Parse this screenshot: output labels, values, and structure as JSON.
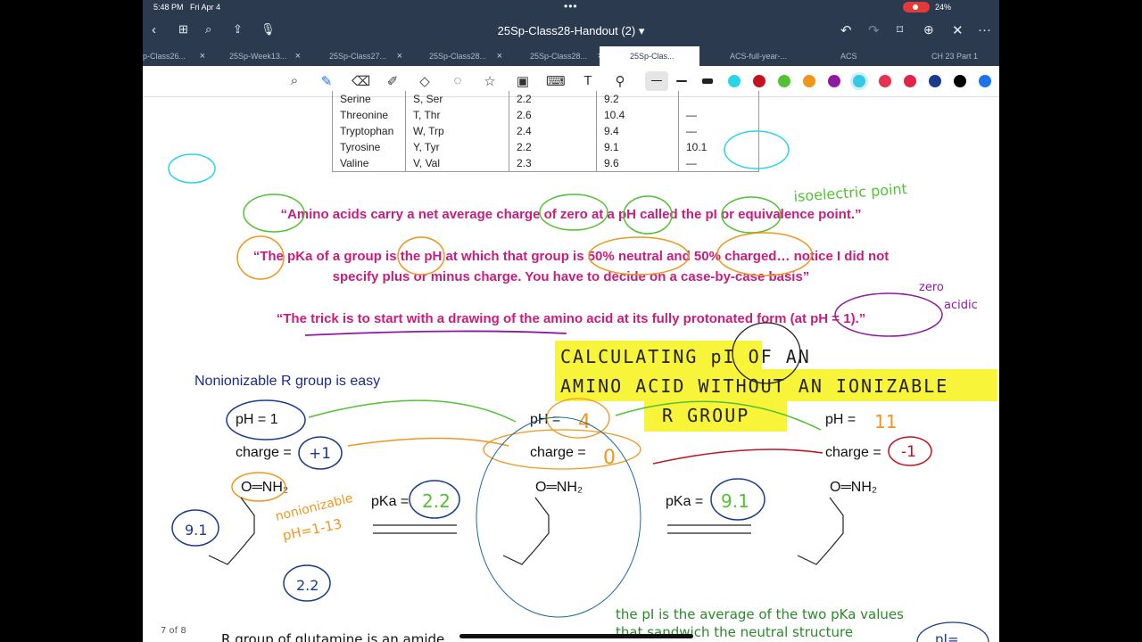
{
  "status": {
    "time": "5:48 PM",
    "date": "Fri Apr 4",
    "battery": "24%"
  },
  "header": {
    "title": "25Sp-Class28-Handout (2)"
  },
  "tabs": [
    {
      "label": "p-Class26..."
    },
    {
      "label": "25Sp-Week13..."
    },
    {
      "label": "25Sp-Class27..."
    },
    {
      "label": "25Sp-Class28..."
    },
    {
      "label": "25Sp-Class28..."
    },
    {
      "label": "25Sp-Clas..."
    },
    {
      "label": "ACS-full-year-..."
    },
    {
      "label": "ACS"
    },
    {
      "label": "CH 23 Part 1"
    }
  ],
  "colors": {
    "swatches": [
      "#2ad4e8",
      "#c2121f",
      "#52c234",
      "#f0961c",
      "#8e1aa0",
      "#35c9e6",
      "#e83050",
      "#e2234a",
      "#1a3b8c",
      "#000000",
      "#1a73e8"
    ],
    "accent": "#c41f7e"
  },
  "table": {
    "rows": [
      [
        "Serine",
        "S, Ser",
        "2.2",
        "9.2",
        ""
      ],
      [
        "Threonine",
        "T, Thr",
        "2.6",
        "10.4",
        "—"
      ],
      [
        "Tryptophan",
        "W, Trp",
        "2.4",
        "9.4",
        "—"
      ],
      [
        "Tyrosine",
        "Y, Tyr",
        "2.2",
        "9.1",
        "10.1"
      ],
      [
        "Valine",
        "V, Val",
        "2.3",
        "9.6",
        "—"
      ]
    ]
  },
  "quotes": {
    "q1": "“Amino acids carry a net average charge of zero at a pH called the pI or equivalence point.”",
    "q2a": "“The pKa of a group is the pH at which that group is 50% neutral and 50% charged… notice I did not",
    "q2b": "specify plus or minus charge. You have to decide on a case-by-case basis”",
    "q3": "“The trick is to start with a drawing of the amino acid at its fully protonated form (at pH = 1).”"
  },
  "notes": {
    "isoelectric": "isoelectric point",
    "zero": "zero",
    "acidic": "acidic",
    "heading1": "CALCULATING pI OF AN",
    "heading2": "AMINO ACID WITHOUT AN IONIZABLE",
    "heading3": "R GROUP",
    "nonionizable": "nonionizable",
    "ph_range": "pH=1-13",
    "pka1": "2.2",
    "pka2": "9.1",
    "ph_mid": "4",
    "ph_right": "11",
    "charge_left": "+1",
    "charge_mid": "0",
    "charge_right": "-1",
    "cooh_pka": "2.2",
    "n_pka": "9.1"
  },
  "body": {
    "nonionizable_label": "Nonionizable R group is easy",
    "ph_eq": "pH =",
    "ph1": "pH = 1",
    "charge_eq": "charge =",
    "nh2": "O═NH₂",
    "pka_label": "pKa =",
    "page_number": "7 of 8",
    "note_pi_1": "the pI is the average of the two pKa values",
    "note_pi_2": "that sandwich the neutral structure",
    "bottom_text": "R group of glutamine is an amide",
    "pi_corner": "pI="
  }
}
